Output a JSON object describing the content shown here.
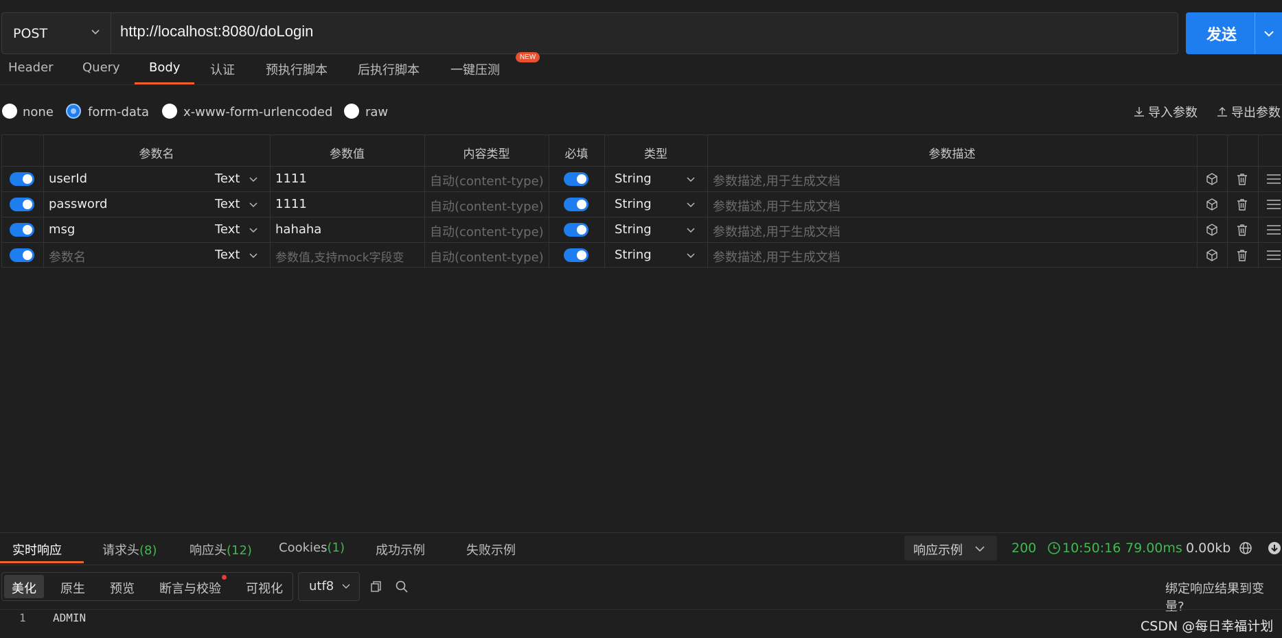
{
  "request": {
    "method": "POST",
    "url": "http://localhost:8080/doLogin",
    "send_label": "发送"
  },
  "tabs": [
    {
      "label": "Header"
    },
    {
      "label": "Query"
    },
    {
      "label": "Body",
      "active": true
    },
    {
      "label": "认证"
    },
    {
      "label": "预执行脚本"
    },
    {
      "label": "后执行脚本"
    },
    {
      "label": "一键压测",
      "badge": "NEW"
    }
  ],
  "body_types": {
    "options": [
      "none",
      "form-data",
      "x-www-form-urlencoded",
      "raw"
    ],
    "selected": "form-data",
    "import_label": "导入参数",
    "export_label": "导出参数"
  },
  "params_table": {
    "headers": [
      "参数名",
      "参数值",
      "内容类型",
      "必填",
      "类型",
      "参数描述"
    ],
    "rows": [
      {
        "enabled": true,
        "name": "userId",
        "value_type": "Text",
        "value": "1111",
        "content_type": "自动(content-type)",
        "required": true,
        "type": "String",
        "description": "参数描述,用于生成文档"
      },
      {
        "enabled": true,
        "name": "password",
        "value_type": "Text",
        "value": "1111",
        "content_type": "自动(content-type)",
        "required": true,
        "type": "String",
        "description": "参数描述,用于生成文档"
      },
      {
        "enabled": true,
        "name": "msg",
        "value_type": "Text",
        "value": "hahaha",
        "content_type": "自动(content-type)",
        "required": true,
        "type": "String",
        "description": "参数描述,用于生成文档"
      },
      {
        "enabled": true,
        "name": "参数名",
        "name_placeholder": true,
        "value_type": "Text",
        "value": "参数值,支持mock字段变",
        "value_placeholder": true,
        "content_type": "自动(content-type)",
        "required": true,
        "type": "String",
        "description": "参数描述,用于生成文档"
      }
    ]
  },
  "response": {
    "tabs": [
      {
        "label": "实时响应",
        "active": true
      },
      {
        "label": "请求头",
        "count": "(8)"
      },
      {
        "label": "响应头",
        "count": "(12)"
      },
      {
        "label": "Cookies",
        "count": "(1)"
      },
      {
        "label": "成功示例"
      },
      {
        "label": "失败示例"
      }
    ],
    "example_select": "响应示例",
    "status_code": "200",
    "time": "10:50:16",
    "duration": "79.00ms",
    "size": "0.00kb",
    "formats": [
      "美化",
      "原生",
      "预览",
      "断言与校验",
      "可视化"
    ],
    "active_format": "美化",
    "encoding": "utf8",
    "bind_label": "绑定响应结果到变量?",
    "body_lines": [
      {
        "num": "1",
        "text": "ADMIN"
      }
    ]
  },
  "watermark": "CSDN @每日幸福计划",
  "colors": {
    "accent": "#1e7ef0",
    "tab_underline": "#f0602d",
    "status_ok": "#3fb950",
    "badge": "#e9502d"
  }
}
